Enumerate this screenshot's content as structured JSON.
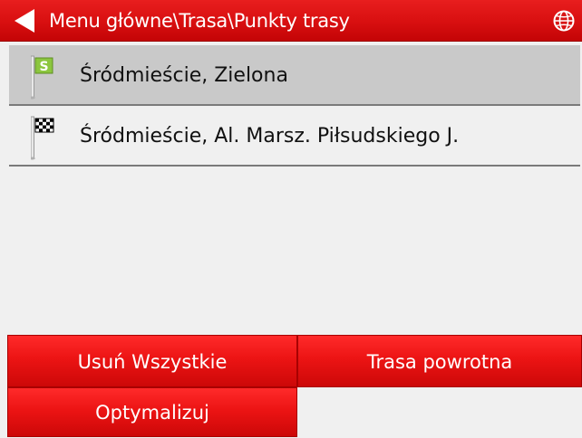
{
  "header": {
    "breadcrumb": "Menu główne\\Trasa\\Punkty trasy",
    "back_icon": "back-arrow-icon",
    "globe_icon": "globe-icon"
  },
  "waypoints": [
    {
      "label": "Śródmieście, Zielona",
      "icon": "start-flag-icon",
      "flag_letter": "S",
      "selected": true
    },
    {
      "label": "Śródmieście, Al. Marsz. Piłsudskiego J.",
      "icon": "finish-flag-icon",
      "selected": false
    }
  ],
  "actions": {
    "remove_all": "Usuń Wszystkie",
    "return_route": "Trasa powrotna",
    "optimize": "Optymalizuj"
  },
  "colors": {
    "accent_red": "#e01010",
    "start_flag_green": "#8cc63f",
    "selected_row": "#c9c9c9",
    "background": "#f0f0f0"
  }
}
